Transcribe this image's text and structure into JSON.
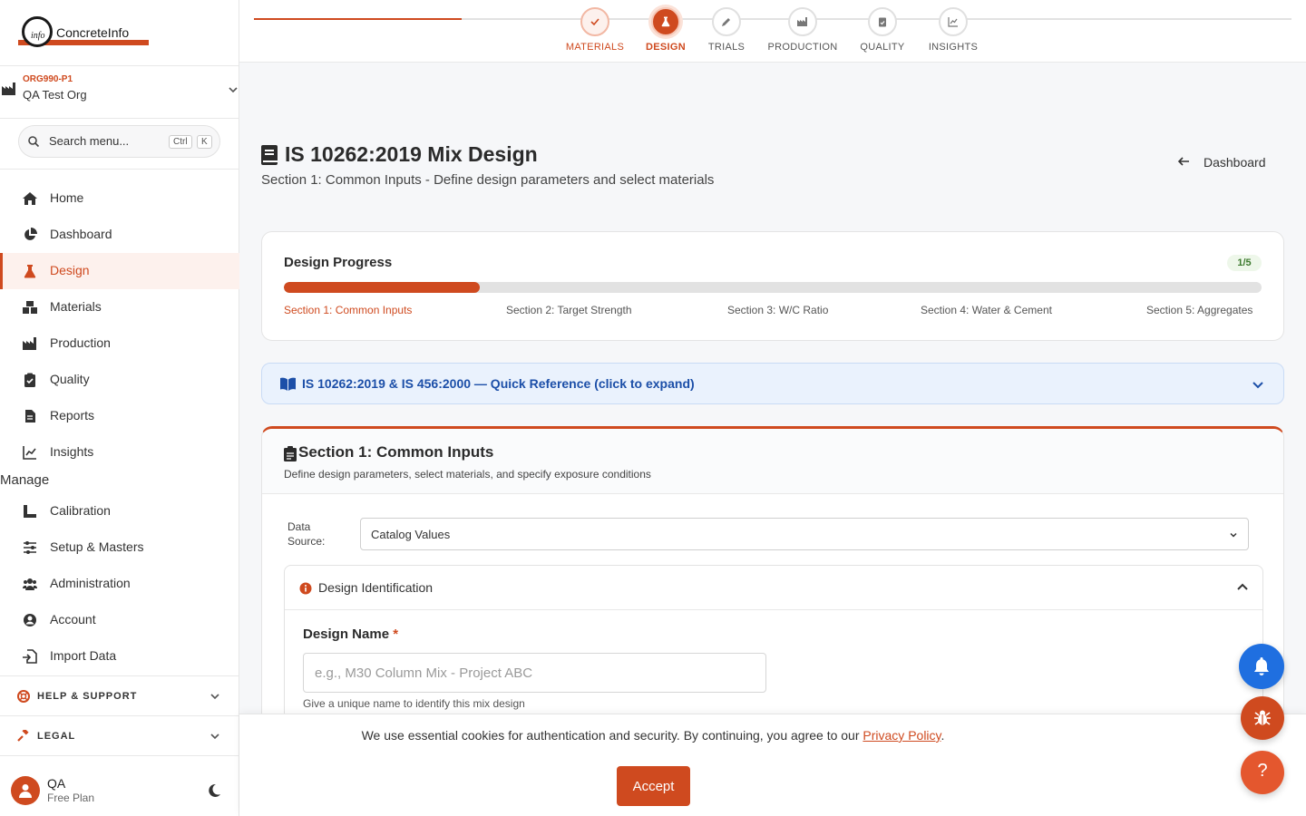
{
  "brand": {
    "logo_inner": "info",
    "logo_text": "ConcreteInfo"
  },
  "org": {
    "code": "ORG990-P1",
    "name": "QA Test Org"
  },
  "search": {
    "placeholder": "Search menu...",
    "kbd_ctrl": "Ctrl",
    "kbd_k": "K"
  },
  "nav": {
    "items": [
      {
        "label": "Home",
        "icon": "home-icon"
      },
      {
        "label": "Dashboard",
        "icon": "pie-chart-icon"
      },
      {
        "label": "Design",
        "icon": "flask-icon",
        "active": true
      },
      {
        "label": "Materials",
        "icon": "cubes-icon"
      },
      {
        "label": "Production",
        "icon": "factory-icon"
      },
      {
        "label": "Quality",
        "icon": "clipboard-check-icon"
      },
      {
        "label": "Reports",
        "icon": "file-icon"
      },
      {
        "label": "Insights",
        "icon": "line-chart-icon"
      }
    ],
    "manage_label": "Manage",
    "manage_items": [
      {
        "label": "Calibration",
        "icon": "ruler-icon"
      },
      {
        "label": "Setup & Masters",
        "icon": "sliders-icon"
      },
      {
        "label": "Administration",
        "icon": "users-icon"
      },
      {
        "label": "Account",
        "icon": "user-circle-icon"
      },
      {
        "label": "Import Data",
        "icon": "file-import-icon"
      }
    ],
    "groups": [
      {
        "label": "HELP & SUPPORT",
        "icon": "lifebuoy-icon"
      },
      {
        "label": "LEGAL",
        "icon": "gavel-icon"
      }
    ]
  },
  "user": {
    "name": "QA",
    "plan": "Free Plan"
  },
  "stepper": {
    "steps": [
      {
        "label": "MATERIALS",
        "state": "done"
      },
      {
        "label": "DESIGN",
        "state": "current"
      },
      {
        "label": "TRIALS",
        "state": "pending"
      },
      {
        "label": "PRODUCTION",
        "state": "pending"
      },
      {
        "label": "QUALITY",
        "state": "pending"
      },
      {
        "label": "INSIGHTS",
        "state": "pending"
      }
    ]
  },
  "page": {
    "title": "IS 10262:2019 Mix Design",
    "subtitle": "Section 1: Common Inputs - Define design parameters and select materials",
    "back_label": "Dashboard"
  },
  "progress": {
    "title": "Design Progress",
    "badge": "1/5",
    "fraction": 0.2,
    "steps": [
      "Section 1: Common Inputs",
      "Section 2: Target Strength",
      "Section 3: W/C Ratio",
      "Section 4: Water & Cement",
      "Section 5: Aggregates"
    ]
  },
  "reference": {
    "label": "IS 10262:2019 & IS 456:2000 — Quick Reference (click to expand)"
  },
  "section": {
    "title": "Section 1: Common Inputs",
    "subtitle": "Define design parameters, select materials, and specify exposure conditions",
    "data_source_label": "Data Source:",
    "data_source_value": "Catalog Values",
    "panel_title": "Design Identification",
    "design_name_label": "Design Name",
    "design_name_required": "*",
    "design_name_placeholder": "e.g., M30 Column Mix - Project ABC",
    "design_name_value": "",
    "design_name_help": "Give a unique name to identify this mix design"
  },
  "cookie": {
    "text": "We use essential cookies for authentication and security. By continuing, you agree to our ",
    "link": "Privacy Policy",
    "end": ".",
    "accept": "Accept"
  },
  "fab": {
    "help_glyph": "?"
  },
  "colors": {
    "accent": "#cf4a1f",
    "info_blue": "#1c4fa8",
    "notify_blue": "#1f6fe0"
  }
}
